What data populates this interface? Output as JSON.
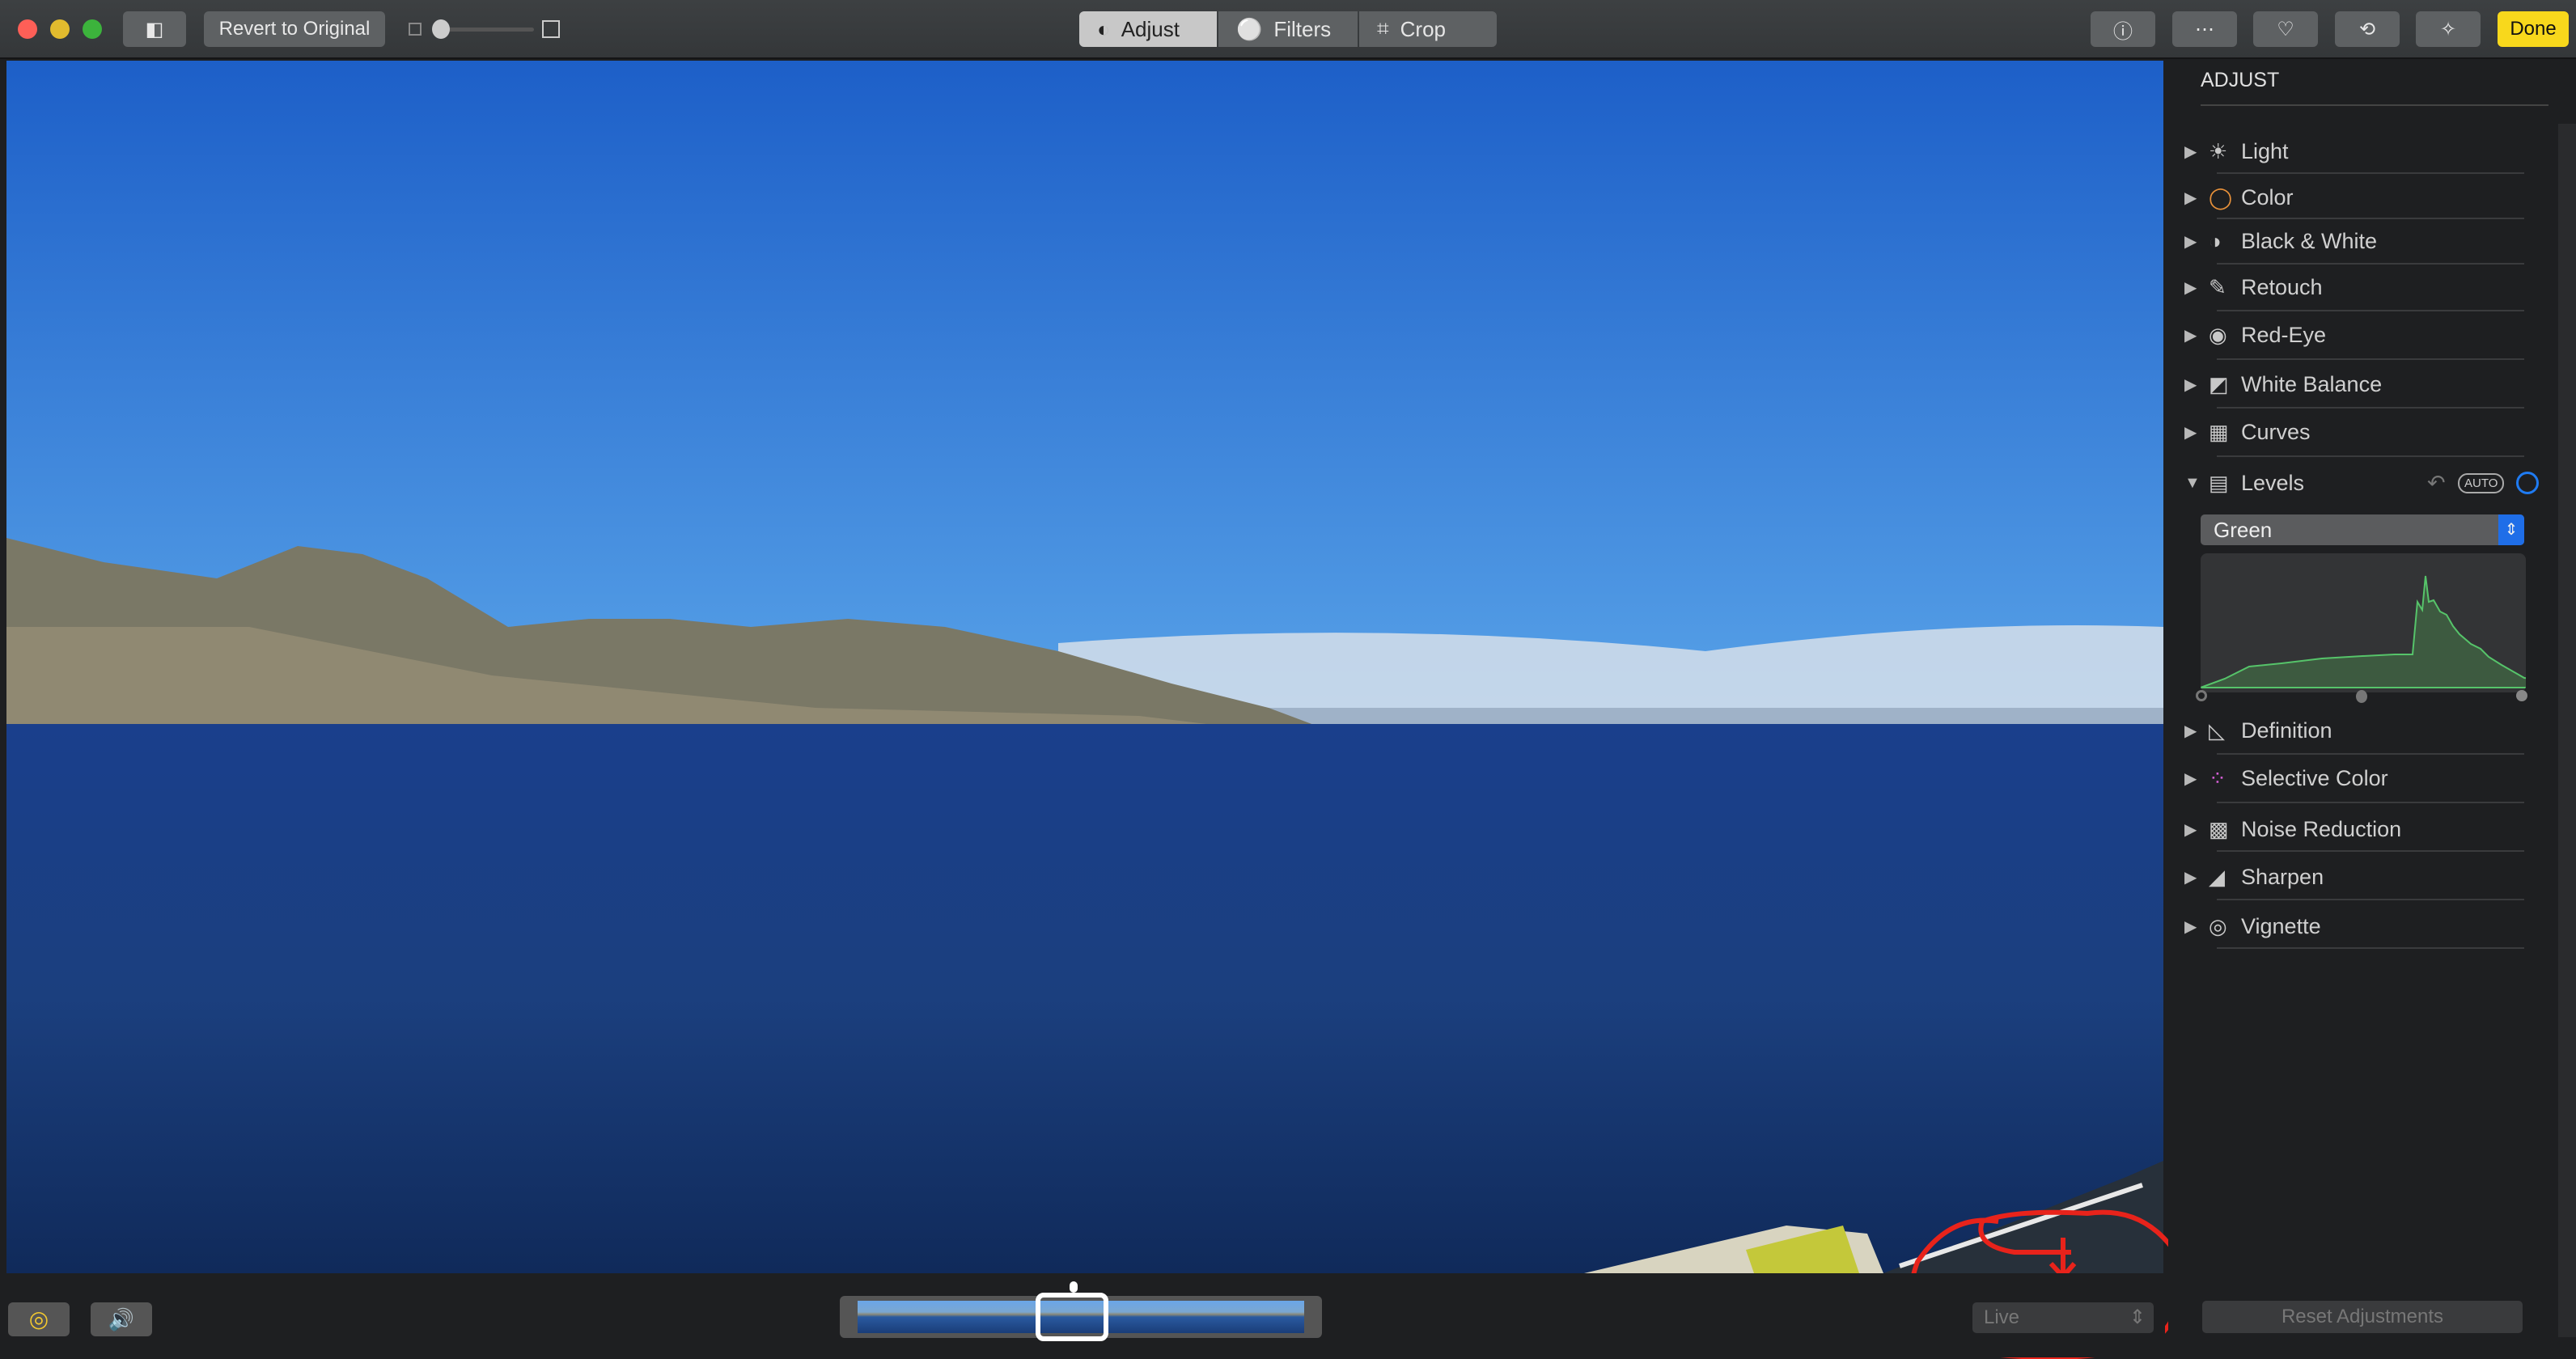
{
  "toolbar": {
    "revert_label": "Revert to Original",
    "tabs": [
      {
        "label": "Adjust",
        "active": true
      },
      {
        "label": "Filters"
      },
      {
        "label": "Crop"
      }
    ],
    "done_label": "Done",
    "right_icons": [
      "info-icon",
      "more-icon",
      "heart-icon",
      "rotate-icon",
      "magic-wand-icon"
    ],
    "done_color": "#f8d81c"
  },
  "panel": {
    "title": "ADJUST",
    "items": [
      {
        "label": "Light",
        "icon": "sun-icon"
      },
      {
        "label": "Color",
        "icon": "color-circle-icon"
      },
      {
        "label": "Black & White",
        "icon": "half-circle-icon"
      },
      {
        "label": "Retouch",
        "icon": "bandage-icon"
      },
      {
        "label": "Red-Eye",
        "icon": "eye-icon"
      },
      {
        "label": "White Balance",
        "icon": "white-balance-icon"
      },
      {
        "label": "Curves",
        "icon": "curves-icon"
      }
    ],
    "levels": {
      "label": "Levels",
      "auto_label": "AUTO",
      "channel": "Green",
      "expanded": true
    },
    "items2": [
      {
        "label": "Definition",
        "icon": "definition-icon"
      },
      {
        "label": "Selective Color",
        "icon": "selective-color-icon"
      },
      {
        "label": "Noise Reduction",
        "icon": "noise-icon"
      },
      {
        "label": "Sharpen",
        "icon": "sharpen-icon"
      },
      {
        "label": "Vignette",
        "icon": "vignette-icon"
      }
    ],
    "reset_label": "Reset Adjustments"
  },
  "bottom": {
    "live_value": "Live"
  }
}
